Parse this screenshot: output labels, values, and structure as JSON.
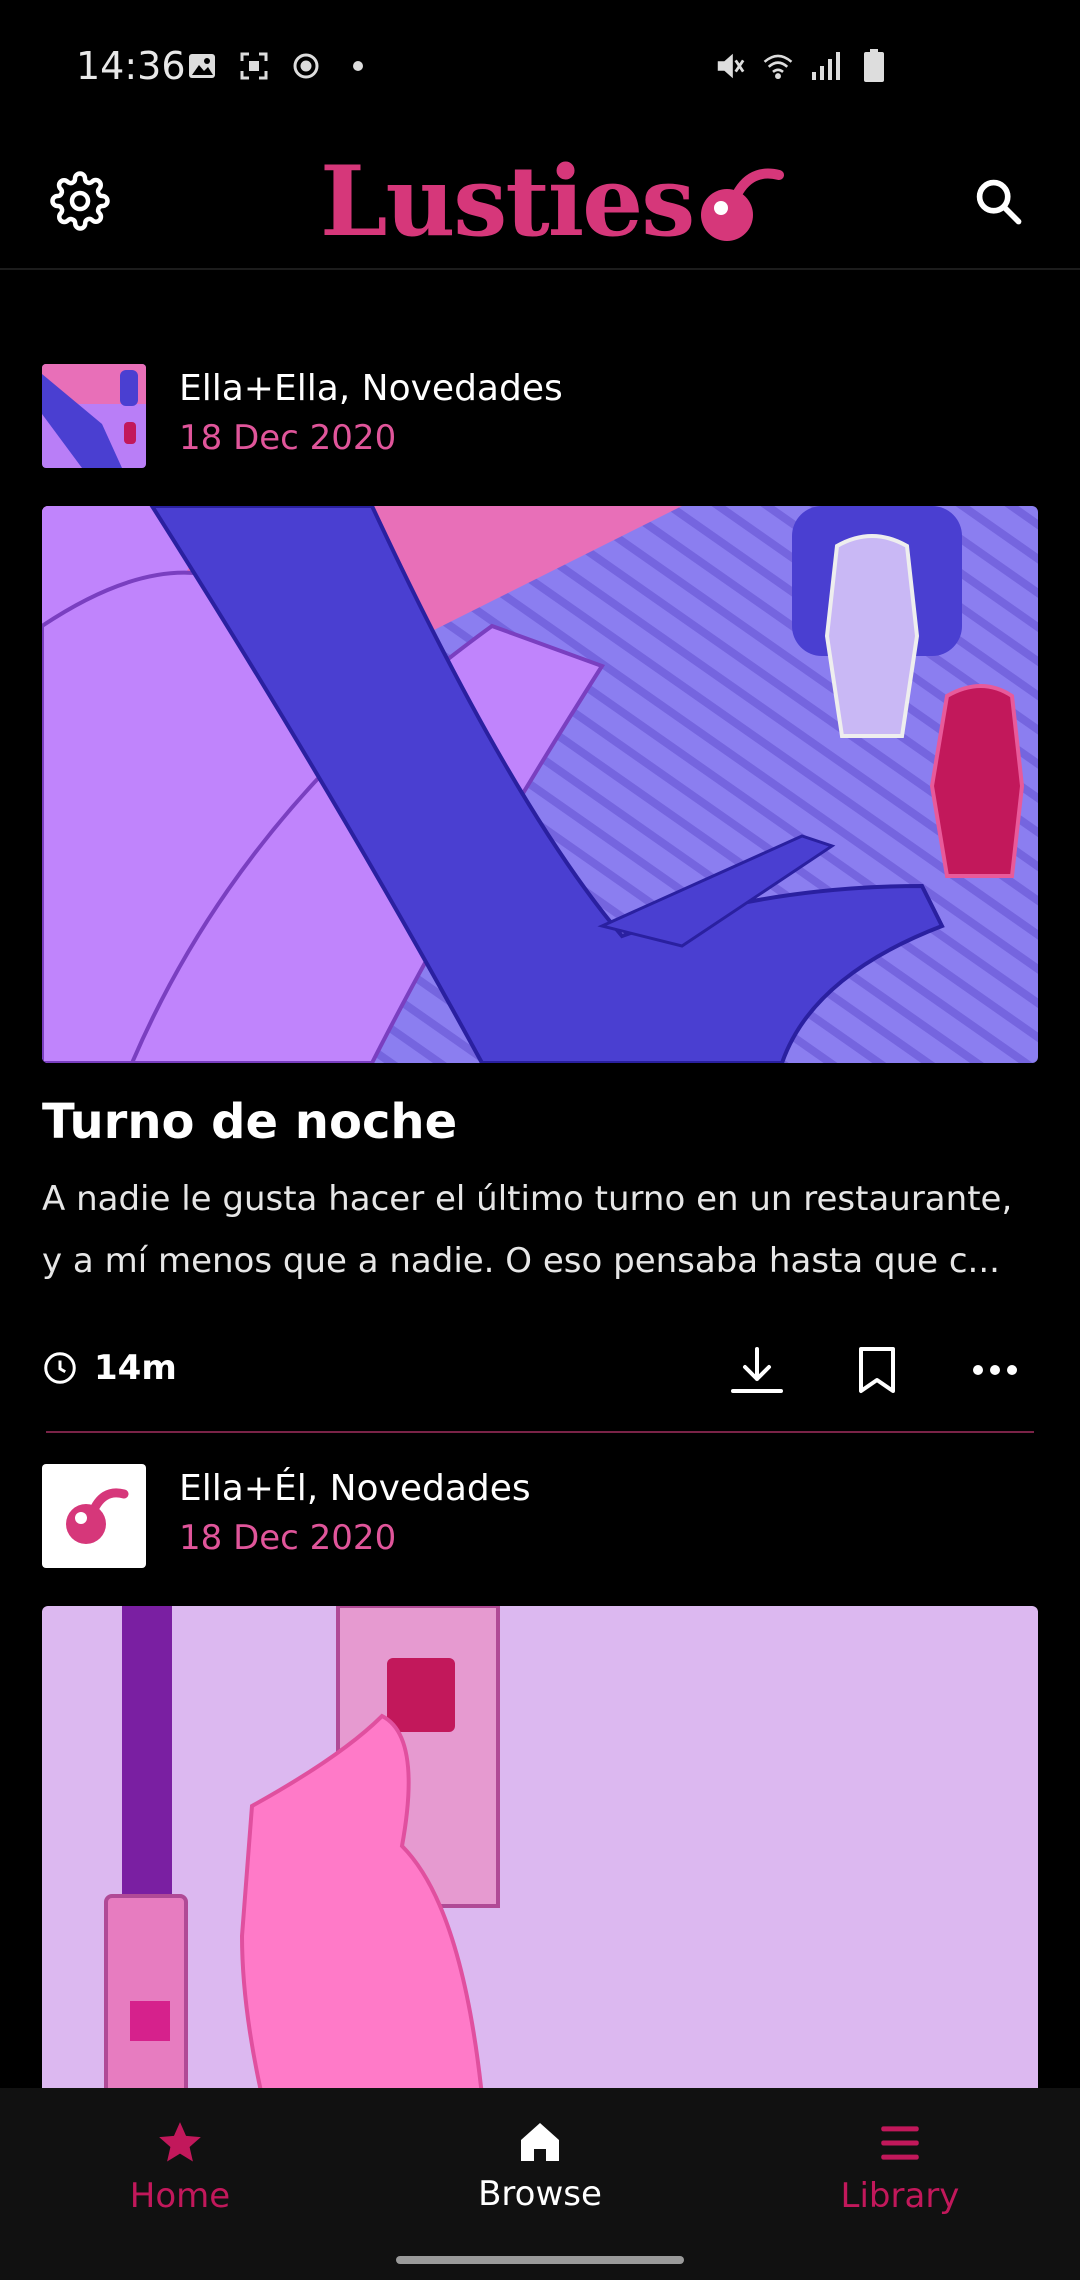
{
  "status_bar": {
    "time": "14:36"
  },
  "app": {
    "logo_text": "Lusties",
    "brand_color": "#d6377a"
  },
  "feed": [
    {
      "category": "Ella+Ella, Novedades",
      "date": "18 Dec 2020",
      "title": "Turno de noche",
      "excerpt_line1": "A nadie le gusta hacer el último turno en un restaurante,",
      "excerpt_line2": "y a mí menos que a nadie. O eso pensaba hasta que c...",
      "duration": "14m"
    },
    {
      "category": "Ella+Él, Novedades",
      "date": "18 Dec 2020"
    }
  ],
  "bottom_nav": {
    "home": "Home",
    "browse": "Browse",
    "library": "Library",
    "active": "browse"
  },
  "icons": [
    "settings-icon",
    "search-icon",
    "clock-icon",
    "download-icon",
    "bookmark-icon",
    "more-icon",
    "star-icon",
    "home-icon",
    "library-icon"
  ]
}
